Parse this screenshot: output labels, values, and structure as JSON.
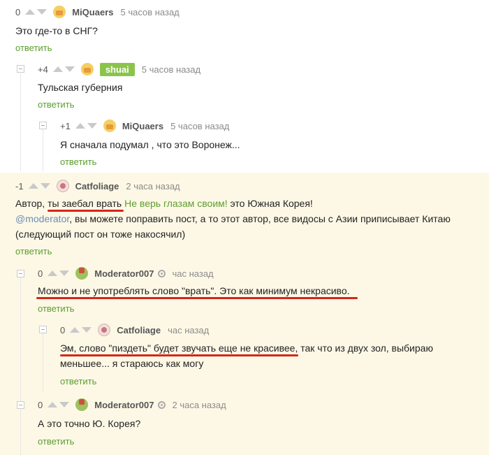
{
  "reply_label": "ответить",
  "comments": [
    {
      "rating": "0",
      "author": "MiQuaers",
      "time": "5 часов назад",
      "text": "Это где-то в СНГ?"
    },
    {
      "rating": "+4",
      "author": "shuai",
      "time": "5 часов назад",
      "text": "Тульская губерния"
    },
    {
      "rating": "+1",
      "author": "MiQuaers",
      "time": "5 часов назад",
      "text": "Я сначала подумал , что это Воронеж..."
    },
    {
      "rating": "-1",
      "author": "Catfoliage",
      "time": "2 часа назад",
      "line1_a": "Автор, ",
      "line1_b": "ты заебал врать",
      "line1_c": " ",
      "line1_green": "Не верь глазам своим!",
      "line1_d": " это Южная Корея!",
      "line2_link": "@moderator",
      "line2_rest": ", вы можете поправить пост, а то этот автор, все видосы с Азии приписывает Китаю",
      "line3": "(следующий пост он тоже накосячил)"
    },
    {
      "rating": "0",
      "author": "Moderator007",
      "time": "час назад",
      "text": "Можно и не употреблять слово \"врать\". Это как минимум некрасиво."
    },
    {
      "rating": "0",
      "author": "Catfoliage",
      "time": "час назад",
      "line1": "Эм, слово \"пиздеть\" будет звучать еще не красивее, так что из двух зол, выбираю",
      "line2": "меньшее... я стараюсь как могу"
    },
    {
      "rating": "0",
      "author": "Moderator007",
      "time": "2 часа назад",
      "text": "А это точно Ю. Корея?"
    }
  ],
  "colors": {
    "highlight_bg": "#fdf8e6",
    "reply_green": "#5c9e2f",
    "underline_red": "#d4261c",
    "badge_green": "#8bc44a"
  }
}
